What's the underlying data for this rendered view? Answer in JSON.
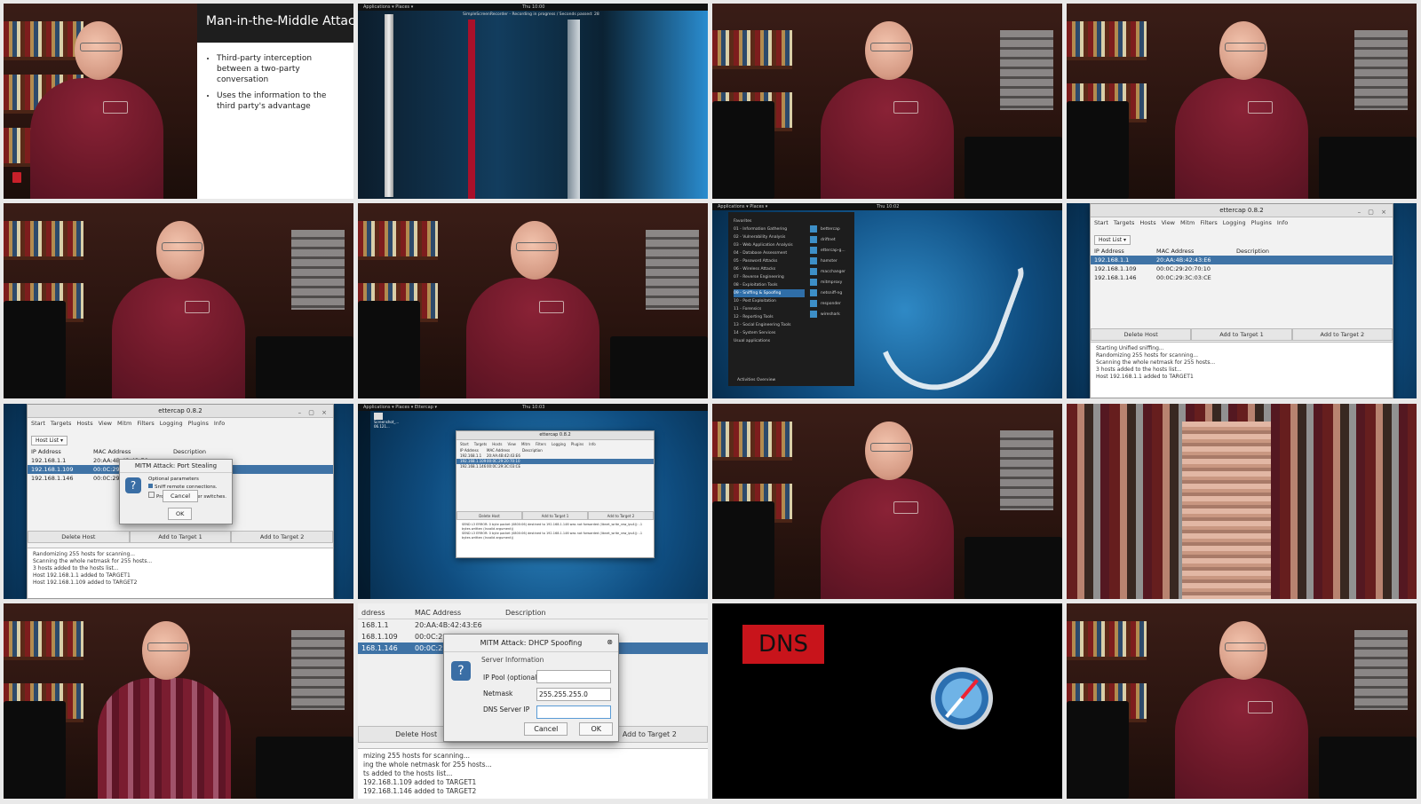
{
  "slide": {
    "title": "Man-in-the-Middle Attack",
    "bullets": [
      "Third-party interception between a two-party conversation",
      "Uses the information to the third party's advantage"
    ]
  },
  "recorder": {
    "topbar_apps": "Applications ▾   Places ▾",
    "clock": "Thu 10:00",
    "banner": "SimpleScreenRecorder - Recording in progress / Seconds passed: 28"
  },
  "kali_menu": {
    "topbar": "Applications ▾   Places ▾",
    "clock": "Thu 10:02",
    "categories": [
      "Favorites",
      "01 - Information Gathering",
      "02 - Vulnerability Analysis",
      "03 - Web Application Analysis",
      "04 - Database Assessment",
      "05 - Password Attacks",
      "06 - Wireless Attacks",
      "07 - Reverse Engineering",
      "08 - Exploitation Tools",
      "09 - Sniffing & Spoofing",
      "10 - Post Exploitation",
      "11 - Forensics",
      "12 - Reporting Tools",
      "13 - Social Engineering Tools",
      "14 - System Services",
      "Usual applications"
    ],
    "apps": [
      "bettercap",
      "driftnet",
      "ettercap-g...",
      "hamster",
      "macchanger",
      "mitmproxy",
      "netsniff-ng",
      "responder",
      "wireshark"
    ],
    "activities": "Activities Overview"
  },
  "ettercap": {
    "title": "ettercap 0.8.2",
    "menu": [
      "Start",
      "Targets",
      "Hosts",
      "View",
      "Mitm",
      "Filters",
      "Logging",
      "Plugins",
      "Info"
    ],
    "tab": "Host List ▾",
    "columns": [
      "IP Address",
      "MAC Address",
      "Description"
    ],
    "hosts": [
      {
        "ip": "192.168.1.1",
        "mac": "20:AA:4B:42:43:E6"
      },
      {
        "ip": "192.168.1.109",
        "mac": "00:0C:29:20:70:10"
      },
      {
        "ip": "192.168.1.146",
        "mac": "00:0C:29:3C:03:CE"
      }
    ],
    "buttons": [
      "Delete Host",
      "Add to Target 1",
      "Add to Target 2"
    ],
    "log1": [
      "Starting Unified sniffing...",
      "",
      "Randomizing 255 hosts for scanning...",
      "Scanning the whole netmask for 255 hosts...",
      "3 hosts added to the hosts list...",
      "Host 192.168.1.1 added to TARGET1"
    ],
    "log2": [
      "Randomizing 255 hosts for scanning...",
      "Scanning the whole netmask for 255 hosts...",
      "3 hosts added to the hosts list...",
      "Host 192.168.1.1 added to TARGET1",
      "Host 192.168.1.109 added to TARGET2"
    ],
    "log3": [
      "SEND L3 ERROR: 0 byte packet (0800:06) destined to 192.168.1.146 was not forwarded (libnet_write_raw_ipv4(): -1 bytes written (Invalid argument))",
      "SEND L3 ERROR: 0 byte packet (0800:06) destined to 192.168.1.146 was not forwarded (libnet_write_raw_ipv4(): -1 bytes written (Invalid argument))"
    ],
    "log4": [
      "mizing 255 hosts for scanning...",
      "ing the whole netmask for 255 hosts...",
      "ts added to the hosts list...",
      "192.168.1.109 added to TARGET1",
      "192.168.1.146 added to TARGET2"
    ]
  },
  "port_stealing": {
    "title": "MITM Attack: Port Stealing",
    "section": "Optional parameters",
    "opt1": "Sniff remote connections.",
    "opt2": "Propagate to other switches.",
    "cancel": "Cancel",
    "ok": "OK"
  },
  "dhcp": {
    "title": "MITM Attack: DHCP Spoofing",
    "section": "Server Information",
    "ip_pool_label": "IP Pool (optional)",
    "ip_pool_value": "",
    "netmask_label": "Netmask",
    "netmask_value": "255.255.255.0",
    "dns_label": "DNS Server IP",
    "dns_value": "",
    "cancel": "Cancel",
    "ok": "OK",
    "columns": [
      "ddress",
      "MAC Address",
      "Description"
    ],
    "hosts": [
      {
        "ip": "168.1.1",
        "mac": "20:AA:4B:42:43:E6"
      },
      {
        "ip": "168.1.109",
        "mac": "00:0C:29:20:70:10"
      },
      {
        "ip": "168.1.146",
        "mac": "00:0C:29:3C:03"
      }
    ],
    "delete": "Delete Host",
    "add2": "Add to Target 2"
  },
  "desktop2": {
    "topbar": "Applications ▾   Places ▾   Ettercap ▾",
    "clock": "Thu 10:03",
    "folder": "Screenshot_...",
    "folder_date": "06.121..."
  },
  "dns": {
    "label": "DNS"
  },
  "icons": [
    "question-icon",
    "compass-icon",
    "folder-icon"
  ]
}
